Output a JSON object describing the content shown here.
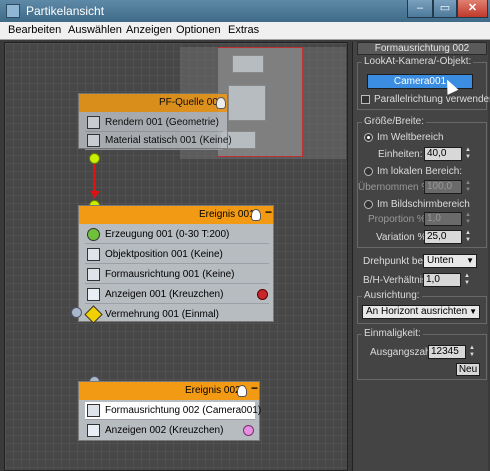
{
  "window": {
    "title": "Partikelansicht"
  },
  "menu": [
    "Bearbeiten",
    "Auswählen",
    "Anzeigen",
    "Optionen",
    "Extras"
  ],
  "canvas": {
    "source_node": {
      "title": "PF-Quelle 001",
      "ops": [
        "Rendern 001 (Geometrie)",
        "Material statisch 001 (Keine)"
      ]
    },
    "event1": {
      "title": "Ereignis 001",
      "ops": [
        "Erzeugung 001 (0-30 T:200)",
        "Objektposition 001 (Keine)",
        "Formausrichtung 001 (Keine)",
        "Anzeigen 001 (Kreuzchen)",
        "Vermehrung 001 (Einmal)"
      ],
      "display_color": "#c8262a"
    },
    "event2": {
      "title": "Ereignis 002",
      "ops": [
        "Formausrichtung 002 (Camera001)",
        "Anzeigen 002 (Kreuzchen)"
      ],
      "display_color": "#e68ee0"
    },
    "close_glyph": "−"
  },
  "panel": {
    "title": "Formausrichtung 002",
    "lookat": {
      "label": "LookAt-Kamera/-Objekt:",
      "button": "Camera001",
      "parallel": "Parallelrichtung verwenden"
    },
    "size": {
      "label": "Größe/Breite:",
      "world": "Im Weltbereich",
      "units_label": "Einheiten:",
      "units": "40,0",
      "local": "Im lokalen Bereich:",
      "inherit_label": "Übernommen %",
      "inherit": "100,0",
      "screen": "Im Bildschirmbereich",
      "proportion_label": "Proportion %",
      "proportion": "1,0",
      "variation_label": "Variation %",
      "variation": "25,0"
    },
    "pivot": {
      "label": "Drehpunkt bei:",
      "value": "Unten"
    },
    "aspect": {
      "label": "B/H-Verhältnis:",
      "value": "1,0"
    },
    "orient": {
      "label": "Ausrichtung:",
      "value": "An Horizont ausrichten"
    },
    "unique": {
      "label": "Einmaligkeit:",
      "seed_label": "Ausgangszahl:",
      "seed": "12345",
      "new_button": "Neu"
    }
  },
  "colors": {
    "event_header": "#f39a14",
    "wire": "#e01010",
    "port_green": "#c8f000",
    "selection_blue": "#3a8de0"
  }
}
